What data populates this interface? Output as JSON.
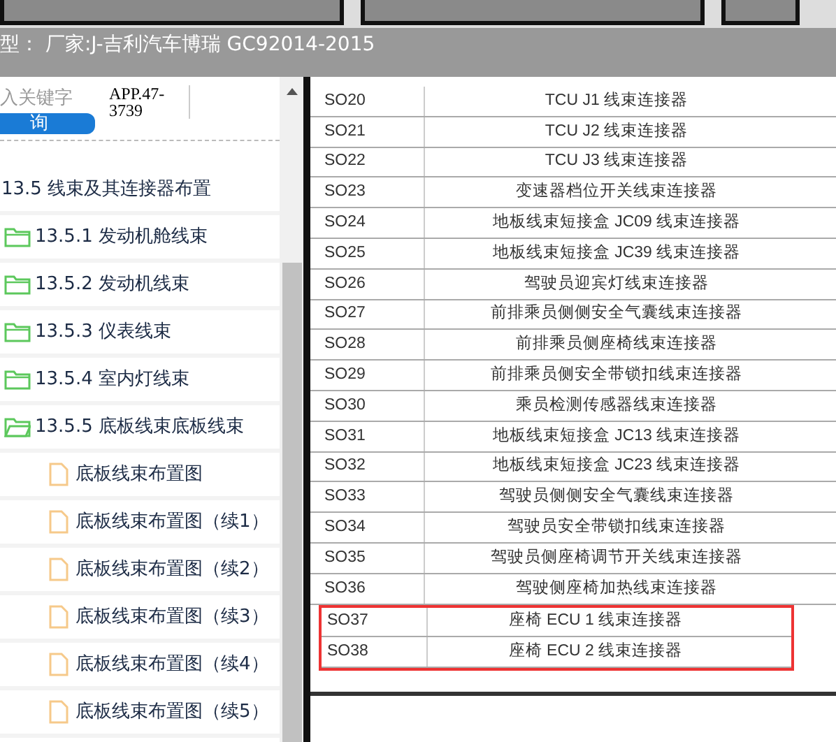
{
  "header": {
    "title": "型： 厂家:J-吉利汽车博瑞 GC92014-2015"
  },
  "search": {
    "placeholder": "入关键字",
    "value": "APP.47-3739",
    "button": "询"
  },
  "tree": [
    {
      "label": "13.5 线束及其连接器布置",
      "children": [
        {
          "label": "13.5.1 发动机舱线束",
          "kind": "folder",
          "expanded": false
        },
        {
          "label": "13.5.2 发动机线束",
          "kind": "folder",
          "expanded": false
        },
        {
          "label": "13.5.3 仪表线束",
          "kind": "folder",
          "expanded": false
        },
        {
          "label": "13.5.4 室内灯线束",
          "kind": "folder",
          "expanded": false
        },
        {
          "label": "13.5.5 底板线束底板线束",
          "kind": "folder",
          "expanded": true,
          "children": [
            {
              "label": "底板线束布置图",
              "kind": "file"
            },
            {
              "label": "底板线束布置图（续1）",
              "kind": "file"
            },
            {
              "label": "底板线束布置图（续2）",
              "kind": "file"
            },
            {
              "label": "底板线束布置图（续3）",
              "kind": "file"
            },
            {
              "label": "底板线束布置图（续4）",
              "kind": "file"
            },
            {
              "label": "底板线束布置图（续5）",
              "kind": "file"
            }
          ]
        }
      ]
    }
  ],
  "table": {
    "rows": [
      {
        "code": "SO20",
        "name": "TCU J1 线束连接器",
        "highlighted": false
      },
      {
        "code": "SO21",
        "name": "TCU J2 线束连接器",
        "highlighted": false
      },
      {
        "code": "SO22",
        "name": "TCU J3 线束连接器",
        "highlighted": false
      },
      {
        "code": "SO23",
        "name": "变速器档位开关线束连接器",
        "highlighted": false
      },
      {
        "code": "SO24",
        "name": "地板线束短接盒 JC09 线束连接器",
        "highlighted": false
      },
      {
        "code": "SO25",
        "name": "地板线束短接盒 JC39 线束连接器",
        "highlighted": false
      },
      {
        "code": "SO26",
        "name": "驾驶员迎宾灯线束连接器",
        "highlighted": false
      },
      {
        "code": "SO27",
        "name": "前排乘员侧侧安全气囊线束连接器",
        "highlighted": false
      },
      {
        "code": "SO28",
        "name": "前排乘员侧座椅线束连接器",
        "highlighted": false
      },
      {
        "code": "SO29",
        "name": "前排乘员侧安全带锁扣线束连接器",
        "highlighted": false
      },
      {
        "code": "SO30",
        "name": "乘员检测传感器线束连接器",
        "highlighted": false
      },
      {
        "code": "SO31",
        "name": "地板线束短接盒 JC13 线束连接器",
        "highlighted": false
      },
      {
        "code": "SO32",
        "name": "地板线束短接盒 JC23 线束连接器",
        "highlighted": false
      },
      {
        "code": "SO33",
        "name": "驾驶员侧侧安全气囊线束连接器",
        "highlighted": false
      },
      {
        "code": "SO34",
        "name": "驾驶员安全带锁扣线束连接器",
        "highlighted": false
      },
      {
        "code": "SO35",
        "name": "驾驶员侧座椅调节开关线束连接器",
        "highlighted": false
      },
      {
        "code": "SO36",
        "name": "驾驶侧座椅加热线束连接器",
        "highlighted": false
      },
      {
        "code": "SO37",
        "name": "座椅 ECU 1 线束连接器",
        "highlighted": true
      },
      {
        "code": "SO38",
        "name": "座椅 ECU 2 线束连接器",
        "highlighted": true
      }
    ]
  }
}
